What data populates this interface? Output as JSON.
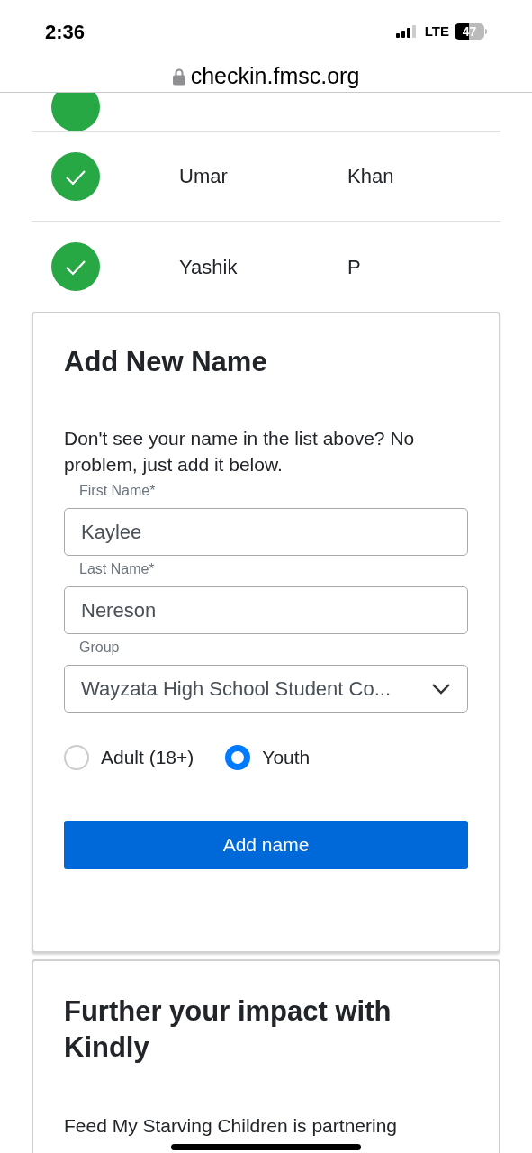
{
  "status_bar": {
    "time": "2:36",
    "network": "LTE",
    "battery": "47"
  },
  "address_bar": {
    "url": "checkin.fmsc.org"
  },
  "rows": [
    {
      "first_name": "Umar",
      "last_name": "Khan",
      "checked": true
    },
    {
      "first_name": "Yashik",
      "last_name": "P",
      "checked": true
    }
  ],
  "add_card": {
    "title": "Add New Name",
    "description": "Don't see your name in the list above? No problem, just add it below.",
    "fields": [
      {
        "kind": "text",
        "label": "First Name*",
        "value": "Kaylee"
      },
      {
        "kind": "text",
        "label": "Last Name*",
        "value": "Nereson"
      },
      {
        "kind": "select",
        "label": "Group",
        "value": "Wayzata High School Student Co..."
      }
    ],
    "radios": [
      {
        "label": "Adult (18+)",
        "selected": false
      },
      {
        "label": "Youth",
        "selected": true
      }
    ],
    "button": "Add name"
  },
  "impact_card": {
    "title": "Further your impact with Kindly",
    "text": "Feed My Starving Children is partnering"
  }
}
